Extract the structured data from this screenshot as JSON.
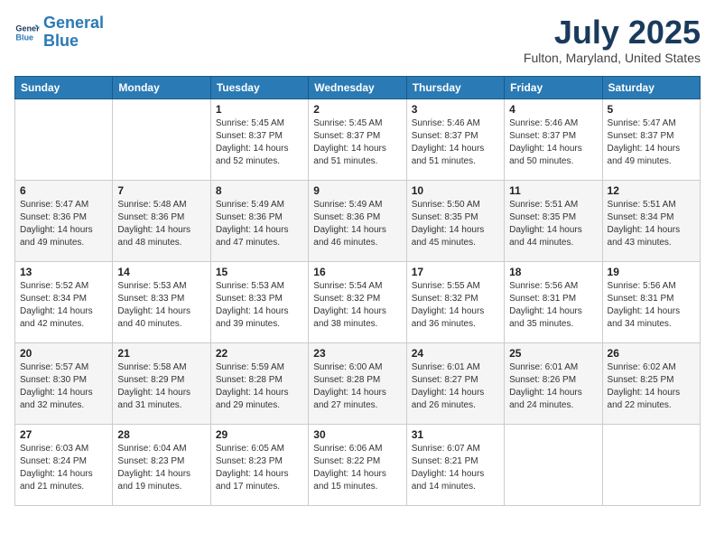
{
  "logo": {
    "line1": "General",
    "line2": "Blue"
  },
  "title": "July 2025",
  "location": "Fulton, Maryland, United States",
  "days_of_week": [
    "Sunday",
    "Monday",
    "Tuesday",
    "Wednesday",
    "Thursday",
    "Friday",
    "Saturday"
  ],
  "weeks": [
    [
      {
        "num": "",
        "info": ""
      },
      {
        "num": "",
        "info": ""
      },
      {
        "num": "1",
        "info": "Sunrise: 5:45 AM\nSunset: 8:37 PM\nDaylight: 14 hours and 52 minutes."
      },
      {
        "num": "2",
        "info": "Sunrise: 5:45 AM\nSunset: 8:37 PM\nDaylight: 14 hours and 51 minutes."
      },
      {
        "num": "3",
        "info": "Sunrise: 5:46 AM\nSunset: 8:37 PM\nDaylight: 14 hours and 51 minutes."
      },
      {
        "num": "4",
        "info": "Sunrise: 5:46 AM\nSunset: 8:37 PM\nDaylight: 14 hours and 50 minutes."
      },
      {
        "num": "5",
        "info": "Sunrise: 5:47 AM\nSunset: 8:37 PM\nDaylight: 14 hours and 49 minutes."
      }
    ],
    [
      {
        "num": "6",
        "info": "Sunrise: 5:47 AM\nSunset: 8:36 PM\nDaylight: 14 hours and 49 minutes."
      },
      {
        "num": "7",
        "info": "Sunrise: 5:48 AM\nSunset: 8:36 PM\nDaylight: 14 hours and 48 minutes."
      },
      {
        "num": "8",
        "info": "Sunrise: 5:49 AM\nSunset: 8:36 PM\nDaylight: 14 hours and 47 minutes."
      },
      {
        "num": "9",
        "info": "Sunrise: 5:49 AM\nSunset: 8:36 PM\nDaylight: 14 hours and 46 minutes."
      },
      {
        "num": "10",
        "info": "Sunrise: 5:50 AM\nSunset: 8:35 PM\nDaylight: 14 hours and 45 minutes."
      },
      {
        "num": "11",
        "info": "Sunrise: 5:51 AM\nSunset: 8:35 PM\nDaylight: 14 hours and 44 minutes."
      },
      {
        "num": "12",
        "info": "Sunrise: 5:51 AM\nSunset: 8:34 PM\nDaylight: 14 hours and 43 minutes."
      }
    ],
    [
      {
        "num": "13",
        "info": "Sunrise: 5:52 AM\nSunset: 8:34 PM\nDaylight: 14 hours and 42 minutes."
      },
      {
        "num": "14",
        "info": "Sunrise: 5:53 AM\nSunset: 8:33 PM\nDaylight: 14 hours and 40 minutes."
      },
      {
        "num": "15",
        "info": "Sunrise: 5:53 AM\nSunset: 8:33 PM\nDaylight: 14 hours and 39 minutes."
      },
      {
        "num": "16",
        "info": "Sunrise: 5:54 AM\nSunset: 8:32 PM\nDaylight: 14 hours and 38 minutes."
      },
      {
        "num": "17",
        "info": "Sunrise: 5:55 AM\nSunset: 8:32 PM\nDaylight: 14 hours and 36 minutes."
      },
      {
        "num": "18",
        "info": "Sunrise: 5:56 AM\nSunset: 8:31 PM\nDaylight: 14 hours and 35 minutes."
      },
      {
        "num": "19",
        "info": "Sunrise: 5:56 AM\nSunset: 8:31 PM\nDaylight: 14 hours and 34 minutes."
      }
    ],
    [
      {
        "num": "20",
        "info": "Sunrise: 5:57 AM\nSunset: 8:30 PM\nDaylight: 14 hours and 32 minutes."
      },
      {
        "num": "21",
        "info": "Sunrise: 5:58 AM\nSunset: 8:29 PM\nDaylight: 14 hours and 31 minutes."
      },
      {
        "num": "22",
        "info": "Sunrise: 5:59 AM\nSunset: 8:28 PM\nDaylight: 14 hours and 29 minutes."
      },
      {
        "num": "23",
        "info": "Sunrise: 6:00 AM\nSunset: 8:28 PM\nDaylight: 14 hours and 27 minutes."
      },
      {
        "num": "24",
        "info": "Sunrise: 6:01 AM\nSunset: 8:27 PM\nDaylight: 14 hours and 26 minutes."
      },
      {
        "num": "25",
        "info": "Sunrise: 6:01 AM\nSunset: 8:26 PM\nDaylight: 14 hours and 24 minutes."
      },
      {
        "num": "26",
        "info": "Sunrise: 6:02 AM\nSunset: 8:25 PM\nDaylight: 14 hours and 22 minutes."
      }
    ],
    [
      {
        "num": "27",
        "info": "Sunrise: 6:03 AM\nSunset: 8:24 PM\nDaylight: 14 hours and 21 minutes."
      },
      {
        "num": "28",
        "info": "Sunrise: 6:04 AM\nSunset: 8:23 PM\nDaylight: 14 hours and 19 minutes."
      },
      {
        "num": "29",
        "info": "Sunrise: 6:05 AM\nSunset: 8:23 PM\nDaylight: 14 hours and 17 minutes."
      },
      {
        "num": "30",
        "info": "Sunrise: 6:06 AM\nSunset: 8:22 PM\nDaylight: 14 hours and 15 minutes."
      },
      {
        "num": "31",
        "info": "Sunrise: 6:07 AM\nSunset: 8:21 PM\nDaylight: 14 hours and 14 minutes."
      },
      {
        "num": "",
        "info": ""
      },
      {
        "num": "",
        "info": ""
      }
    ]
  ]
}
